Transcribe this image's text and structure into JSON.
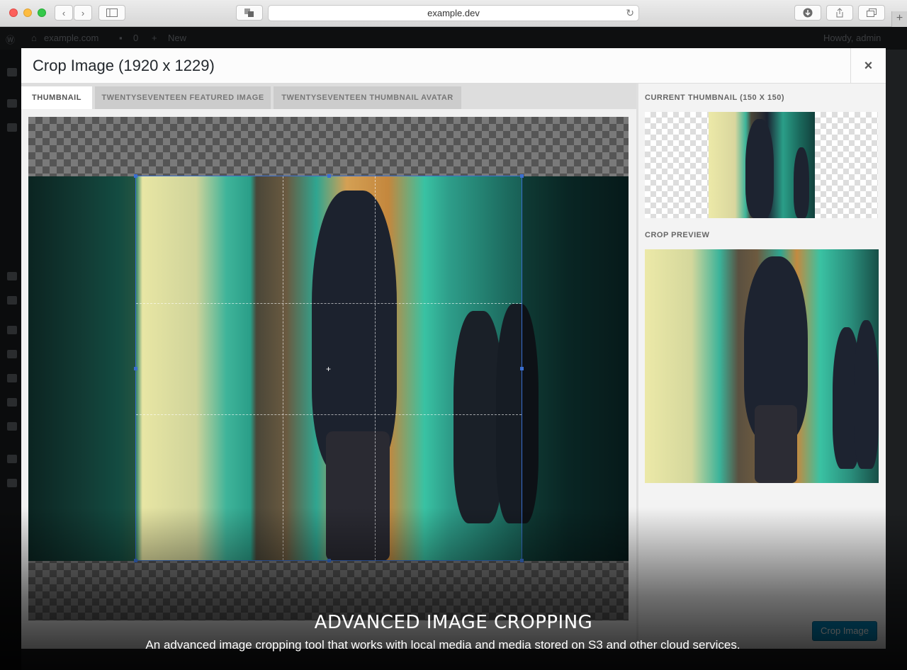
{
  "browser": {
    "url": "example.dev",
    "new_tab_label": "+"
  },
  "adminbar": {
    "site": "example.com",
    "comments": "0",
    "new_label": "New",
    "greeting": "Howdy, admin"
  },
  "modal": {
    "title": "Crop Image (1920 x 1229)",
    "close_label": "×",
    "tabs": [
      {
        "label": "THUMBNAIL",
        "active": true
      },
      {
        "label": "TWENTYSEVENTEEN FEATURED IMAGE",
        "active": false
      },
      {
        "label": "TWENTYSEVENTEEN THUMBNAIL AVATAR",
        "active": false
      }
    ],
    "current_thumbnail_label": "CURRENT THUMBNAIL (150 X 150)",
    "crop_preview_label": "CROP PREVIEW",
    "crop_button_label": "Crop Image",
    "accent_color": "#0085ba",
    "crop_box_color": "#3a6fd1"
  },
  "caption": {
    "title": "ADVANCED IMAGE CROPPING",
    "subtitle": "An advanced image cropping tool that works with local media and media stored on S3 and other cloud services."
  }
}
